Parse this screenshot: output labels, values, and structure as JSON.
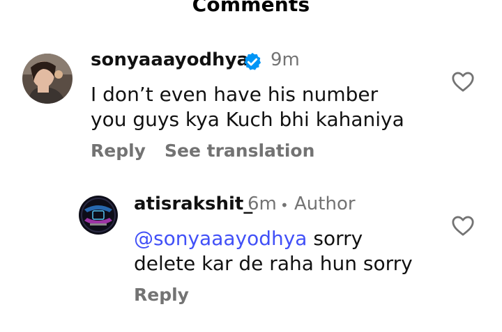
{
  "header": {
    "title": "Comments"
  },
  "comments": [
    {
      "username": "sonyaaayodhya",
      "verified": true,
      "time": "9m",
      "lines": [
        "I don’t even have his number",
        "you guys kya Kuch bhi kahaniya"
      ],
      "actions": {
        "reply": "Reply",
        "translate": "See translation"
      },
      "replies": [
        {
          "username": "atisrakshit_",
          "time": "6m",
          "separator": "•",
          "tag": "Author",
          "mention": "@sonyaaayodhya",
          "line1_rest": " sorry",
          "line2": "delete kar de raha hun sorry",
          "actions": {
            "reply": "Reply"
          }
        }
      ]
    }
  ],
  "colors": {
    "verified": "#0095f6",
    "mention": "#4150f7",
    "muted": "#737373"
  },
  "icons": [
    "heart-icon",
    "verified-badge-icon"
  ]
}
